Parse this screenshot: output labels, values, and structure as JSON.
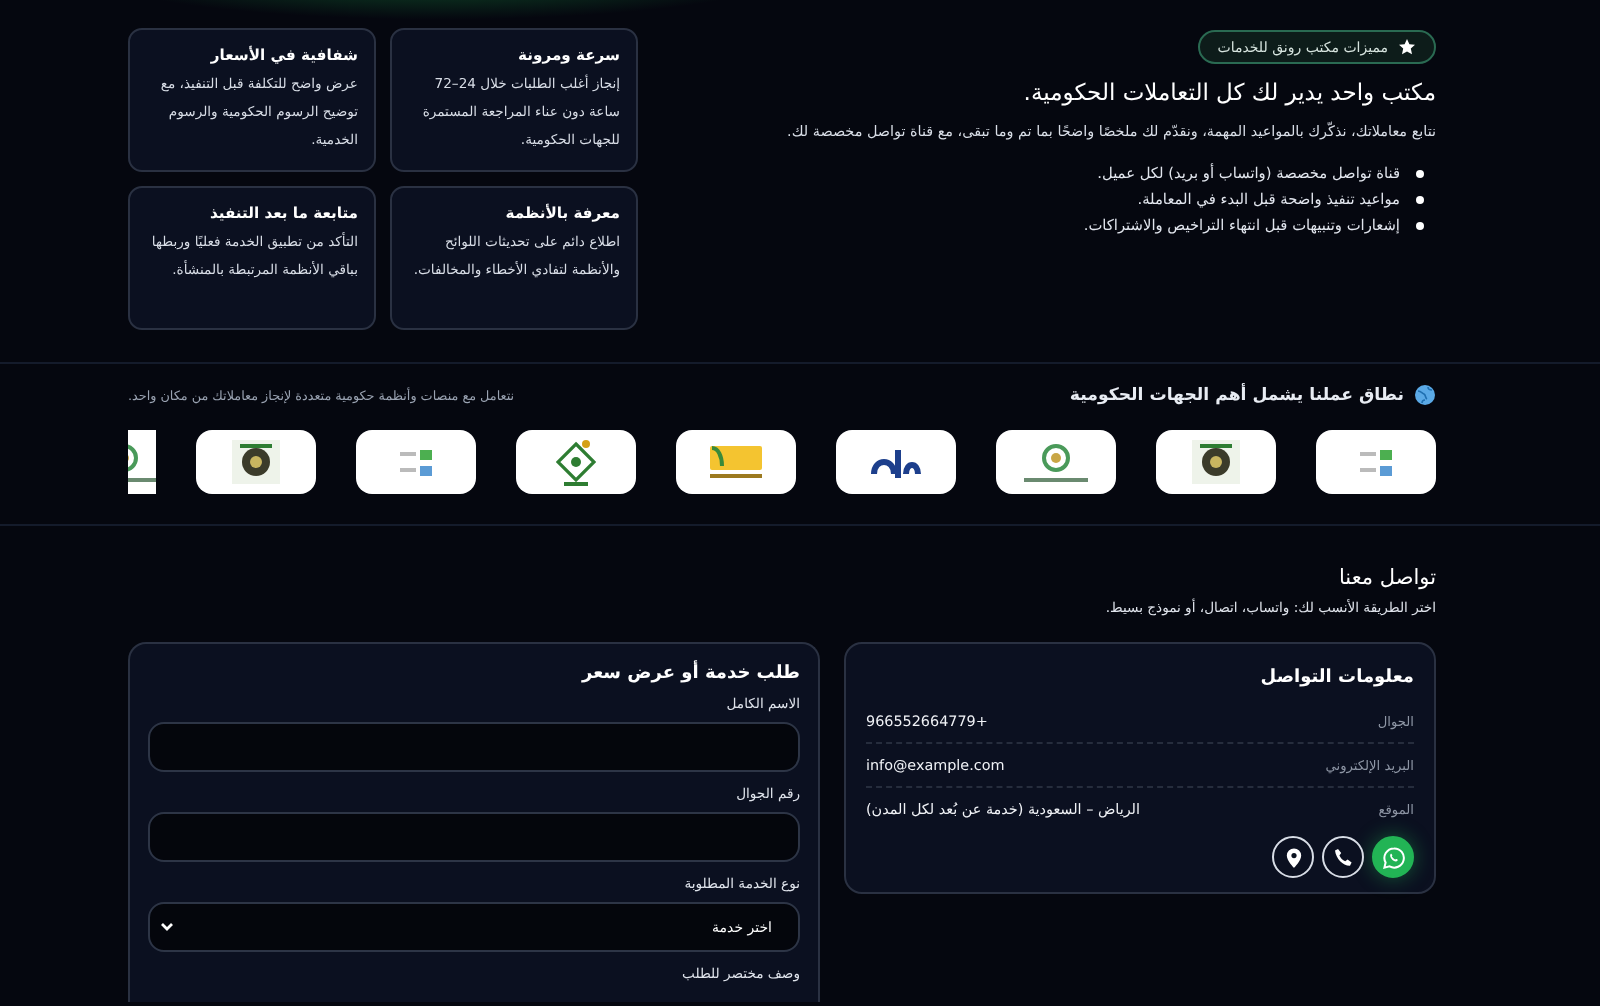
{
  "features": {
    "badge": "مميزات مكتب رونق للخدمات",
    "heading": "مكتب واحد يدير لك كل التعاملات الحكومية.",
    "intro": "نتابع معاملاتك، نذكّرك بالمواعيد المهمة، ونقدّم لك ملخصًا واضحًا بما تم وما تبقى، مع قناة تواصل مخصصة لك.",
    "bullets": [
      "قناة تواصل مخصصة (واتساب أو بريد) لكل عميل.",
      "مواعيد تنفيذ واضحة قبل البدء في المعاملة.",
      "إشعارات وتنبيهات قبل انتهاء التراخيص والاشتراكات."
    ],
    "cards": [
      {
        "title": "سرعة ومرونة",
        "text": "إنجاز أغلب الطلبات خلال 24–72 ساعة دون عناء المراجعة المستمرة للجهات الحكومية."
      },
      {
        "title": "شفافية في الأسعار",
        "text": "عرض واضح للتكلفة قبل التنفيذ، مع توضيح الرسوم الحكومية والرسوم الخدمية."
      },
      {
        "title": "معرفة بالأنظمة",
        "text": "اطلاع دائم على تحديثات اللوائح والأنظمة لتفادي الأخطاء والمخالفات."
      },
      {
        "title": "متابعة ما بعد التنفيذ",
        "text": "التأكد من تطبيق الخدمة فعليًا وربطها بباقي الأنظمة المرتبطة بالمنشأة."
      }
    ]
  },
  "scope": {
    "title": "نطاق عملنا يشمل أهم الجهات الحكومية",
    "subtitle": "نتعامل مع منصات وأنظمة حكومية متعددة لإنجاز معاملاتك من مكان واحد.",
    "logos": [
      {
        "kind": "bars"
      },
      {
        "kind": "emblem"
      },
      {
        "kind": "ring"
      },
      {
        "kind": "wordmark"
      },
      {
        "kind": "leaf"
      },
      {
        "kind": "crest"
      },
      {
        "kind": "bars"
      },
      {
        "kind": "emblem"
      },
      {
        "kind": "ring"
      }
    ]
  },
  "contact": {
    "title": "تواصل معنا",
    "subtitle": "اختر الطريقة الأنسب لك: واتساب، اتصال، أو نموذج بسيط.",
    "info": {
      "title": "معلومات التواصل",
      "rows": [
        {
          "label": "الجوال",
          "value": "+966552664779"
        },
        {
          "label": "البريد الإلكتروني",
          "value": "info@example.com"
        },
        {
          "label": "الموقع",
          "value": "الرياض – السعودية (خدمة عن بُعد لكل المدن)"
        }
      ],
      "actions": [
        {
          "kind": "whatsapp"
        },
        {
          "kind": "phone"
        },
        {
          "kind": "location"
        }
      ]
    },
    "form": {
      "title": "طلب خدمة أو عرض سعر",
      "fields": [
        {
          "kind": "text",
          "label": "الاسم الكامل"
        },
        {
          "kind": "text",
          "label": "رقم الجوال"
        },
        {
          "kind": "select",
          "label": "نوع الخدمة المطلوبة",
          "value": "اختر خدمة"
        },
        {
          "kind": "label",
          "label": "وصف مختصر للطلب"
        }
      ]
    }
  }
}
